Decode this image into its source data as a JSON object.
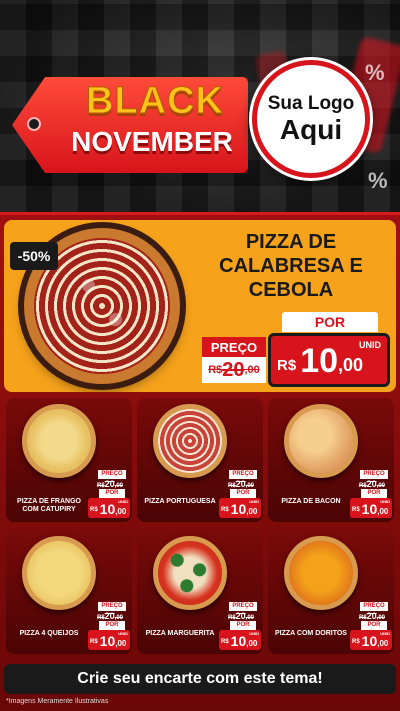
{
  "header": {
    "tag_word_1": "BLACK",
    "tag_word_2": "NOVEMBER",
    "logo_line_1": "Sua Logo",
    "logo_line_2": "Aqui",
    "bg_percent_1": "%",
    "bg_percent_2": "%"
  },
  "hero": {
    "discount": "-50%",
    "name": "PIZZA DE CALABRESA E CEBOLA",
    "preco_label": "PREÇO",
    "old_currency": "R$",
    "old_int": "20",
    "old_dec": ",00",
    "por_label": "POR",
    "unid_label": "UNID",
    "currency": "R$",
    "price_int": "10",
    "price_dec": ",00"
  },
  "products": [
    {
      "name": "PIZZA DE FRANGO COM CATUPIRY",
      "preco_label": "PREÇO",
      "old_currency": "R$",
      "old_int": "20",
      "old_dec": ",00",
      "por_label": "POR",
      "unid_label": "UNID",
      "currency": "R$",
      "price_int": "10",
      "price_dec": ",00"
    },
    {
      "name": "PIZZA PORTUGUESA",
      "preco_label": "PREÇO",
      "old_currency": "R$",
      "old_int": "20",
      "old_dec": ",00",
      "por_label": "POR",
      "unid_label": "UNID",
      "currency": "R$",
      "price_int": "10",
      "price_dec": ",00"
    },
    {
      "name": "PIZZA DE BACON",
      "preco_label": "PREÇO",
      "old_currency": "R$",
      "old_int": "20",
      "old_dec": ",00",
      "por_label": "POR",
      "unid_label": "UNID",
      "currency": "R$",
      "price_int": "10",
      "price_dec": ",00"
    },
    {
      "name": "PIZZA 4 QUEIJOS",
      "preco_label": "PREÇO",
      "old_currency": "R$",
      "old_int": "20",
      "old_dec": ",00",
      "por_label": "POR",
      "unid_label": "UNID",
      "currency": "R$",
      "price_int": "10",
      "price_dec": ",00"
    },
    {
      "name": "PIZZA MARGUERITA",
      "preco_label": "PREÇO",
      "old_currency": "R$",
      "old_int": "20",
      "old_dec": ",00",
      "por_label": "POR",
      "unid_label": "UNID",
      "currency": "R$",
      "price_int": "10",
      "price_dec": ",00"
    },
    {
      "name": "PIZZA COM DORITOS",
      "preco_label": "PREÇO",
      "old_currency": "R$",
      "old_int": "20",
      "old_dec": ",00",
      "por_label": "POR",
      "unid_label": "UNID",
      "currency": "R$",
      "price_int": "10",
      "price_dec": ",00"
    }
  ],
  "cta": {
    "label": "Crie seu encarte com este tema!"
  },
  "footer": {
    "disclaimer": "*Imagens Meramente Ilustrativas"
  },
  "colors": {
    "accent_red": "#d7141b",
    "hero_orange": "#f6a21b",
    "gold": "#ffc21a"
  }
}
